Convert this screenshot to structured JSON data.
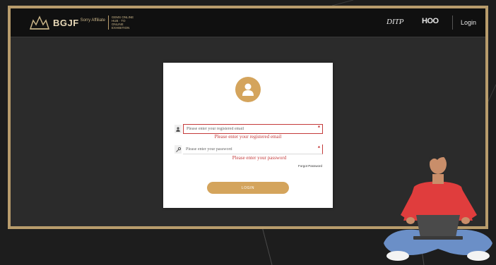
{
  "header": {
    "logo_text": "BGJF",
    "logo_tag": "Sorry Affiliate",
    "logo_subtitle": "GEMS ONLINE HUB · TO ONLINE EXHIBITION",
    "partner1": "DITP",
    "partner2": "HOO",
    "login_label": "Login"
  },
  "form": {
    "email_placeholder": "Please enter your registered email",
    "email_error": "Please enter your registered email",
    "password_placeholder": "Please enter your password",
    "password_error": "Please enter your password",
    "forgot_label": "Forgot Password",
    "login_button": "LOGIN",
    "error_mark": "*"
  },
  "colors": {
    "frame": "#b89c6c",
    "accent": "#d4a45c",
    "error": "#c43a3a",
    "header_bg": "#101010",
    "backdrop": "#2b2b2b"
  },
  "icons": {
    "avatar": "user-icon",
    "email": "user-small-icon",
    "password": "key-icon"
  }
}
